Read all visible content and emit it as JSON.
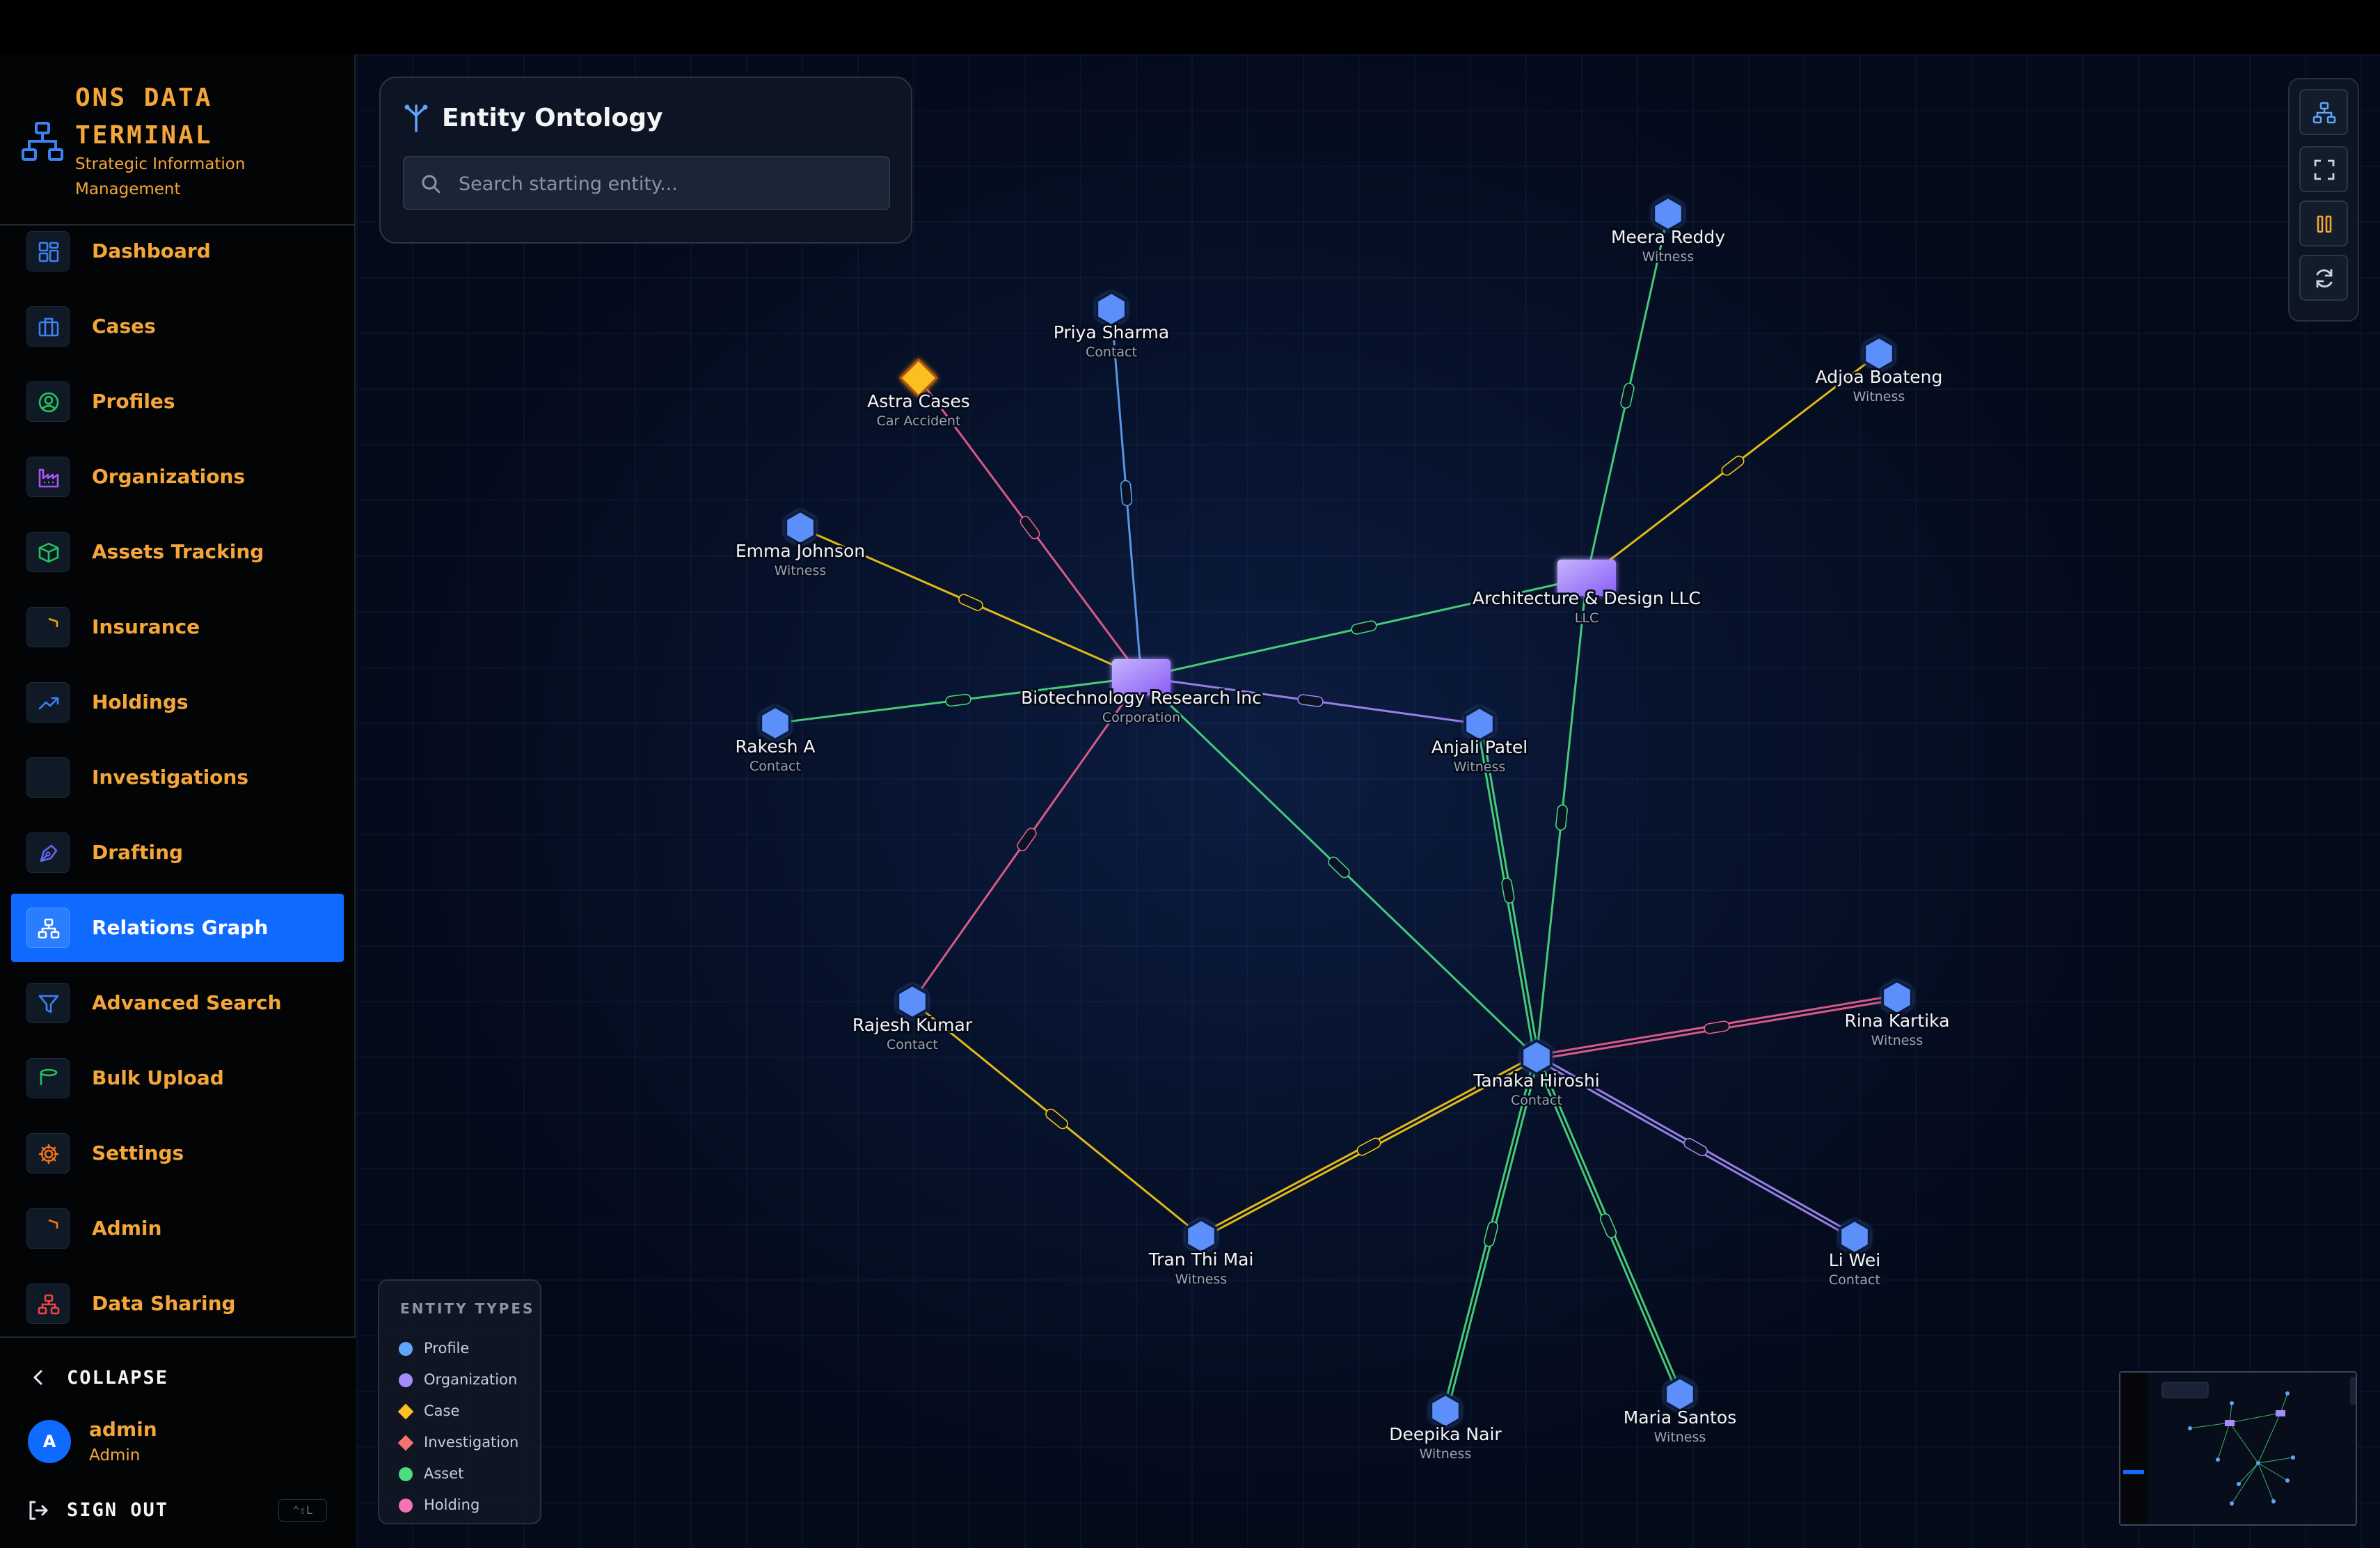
{
  "app": {
    "title": "ONS DATA TERMINAL",
    "subtitle": "Strategic Information Management"
  },
  "sidebar": {
    "items": [
      {
        "label": "Dashboard",
        "icon": "dashboard-icon",
        "color": "#3b82f6"
      },
      {
        "label": "Cases",
        "icon": "briefcase-icon",
        "color": "#3b82f6"
      },
      {
        "label": "Profiles",
        "icon": "user-circle-icon",
        "color": "#22c55e"
      },
      {
        "label": "Organizations",
        "icon": "factory-icon",
        "color": "#a855f7"
      },
      {
        "label": "Assets Tracking",
        "icon": "box-icon",
        "color": "#22c55e"
      },
      {
        "label": "Insurance",
        "icon": "shield-icon",
        "color": "#f59e0b"
      },
      {
        "label": "Holdings",
        "icon": "trending-up-icon",
        "color": "#3b82f6"
      },
      {
        "label": "Investigations",
        "icon": "fingerprint-icon",
        "color": "#f97316"
      },
      {
        "label": "Drafting",
        "icon": "pen-tool-icon",
        "color": "#6366f1"
      },
      {
        "label": "Relations Graph",
        "icon": "network-icon",
        "color": "#ffffff",
        "active": true
      },
      {
        "label": "Advanced Search",
        "icon": "filter-icon",
        "color": "#3b82f6"
      },
      {
        "label": "Bulk Upload",
        "icon": "database-icon",
        "color": "#22c55e"
      },
      {
        "label": "Settings",
        "icon": "settings-icon",
        "color": "#f97316"
      },
      {
        "label": "Admin",
        "icon": "shield-icon",
        "color": "#f97316"
      },
      {
        "label": "Data Sharing",
        "icon": "network-icon",
        "color": "#ef4444"
      }
    ],
    "collapse_label": "COLLAPSE",
    "user": {
      "initial": "A",
      "name": "admin",
      "role": "Admin"
    },
    "signout_label": "SIGN OUT",
    "signout_shortcut": "⌃⇧L"
  },
  "ontology": {
    "title": "Entity Ontology",
    "search_placeholder": "Search starting entity..."
  },
  "legend": {
    "title": "ENTITY TYPES",
    "items": [
      {
        "label": "Profile",
        "color": "#60a5fa",
        "shape": "circle"
      },
      {
        "label": "Organization",
        "color": "#a78bfa",
        "shape": "circle"
      },
      {
        "label": "Case",
        "color": "#fbbf24",
        "shape": "diamond"
      },
      {
        "label": "Investigation",
        "color": "#f87171",
        "shape": "diamond"
      },
      {
        "label": "Asset",
        "color": "#4ade80",
        "shape": "circle"
      },
      {
        "label": "Holding",
        "color": "#f472b6",
        "shape": "circle"
      }
    ]
  },
  "controls": [
    "hierarchy-icon",
    "fullscreen-icon",
    "pause-icon",
    "refresh-icon"
  ],
  "graph": {
    "nodes": [
      {
        "id": "meera",
        "label": "Meera Reddy",
        "sub": "Witness",
        "type": "profile"
      },
      {
        "id": "priya",
        "label": "Priya Sharma",
        "sub": "Contact",
        "type": "profile"
      },
      {
        "id": "astra",
        "label": "Astra Cases",
        "sub": "Car Accident",
        "type": "case"
      },
      {
        "id": "adjoa",
        "label": "Adjoa Boateng",
        "sub": "Witness",
        "type": "profile"
      },
      {
        "id": "emma",
        "label": "Emma Johnson",
        "sub": "Witness",
        "type": "profile"
      },
      {
        "id": "arch",
        "label": "Architecture & Design LLC",
        "sub": "LLC",
        "type": "organization"
      },
      {
        "id": "bio",
        "label": "Biotechnology Research Inc",
        "sub": "Corporation",
        "type": "organization"
      },
      {
        "id": "rakesh",
        "label": "Rakesh A",
        "sub": "Contact",
        "type": "profile"
      },
      {
        "id": "anjali",
        "label": "Anjali Patel",
        "sub": "Witness",
        "type": "profile"
      },
      {
        "id": "rajesh",
        "label": "Rajesh Kumar",
        "sub": "Contact",
        "type": "profile"
      },
      {
        "id": "rina",
        "label": "Rina Kartika",
        "sub": "Witness",
        "type": "profile"
      },
      {
        "id": "tanaka",
        "label": "Tanaka Hiroshi",
        "sub": "Contact",
        "type": "profile"
      },
      {
        "id": "tran",
        "label": "Tran Thi Mai",
        "sub": "Witness",
        "type": "profile"
      },
      {
        "id": "liwei",
        "label": "Li Wei",
        "sub": "Contact",
        "type": "profile"
      },
      {
        "id": "maria",
        "label": "Maria Santos",
        "sub": "Witness",
        "type": "profile"
      },
      {
        "id": "deepika",
        "label": "Deepika Nair",
        "sub": "Witness",
        "type": "profile"
      }
    ],
    "edge_colors": {
      "green": "#4ade80",
      "pink": "#f06292",
      "yellow": "#facc15",
      "purple": "#a78bfa",
      "blue": "#60a5fa"
    }
  }
}
